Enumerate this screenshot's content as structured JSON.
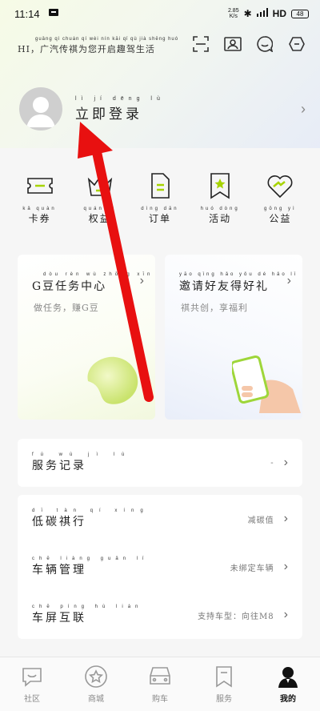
{
  "status": {
    "time": "11:14",
    "net_speed": "2.85",
    "net_unit": "K/s",
    "network": "HD",
    "battery": "48"
  },
  "header": {
    "greeting": "HI，广汽传祺为您开启趣驾生活",
    "greeting_pinyin": "guǎng qì chuán qí wèi nín kāi qǐ qù jià shēng huó"
  },
  "profile": {
    "login_label": "立即登录",
    "login_pinyin": "lì jí dēng lù"
  },
  "quick_actions": [
    {
      "icon": "ticket-icon",
      "label": "卡券",
      "pinyin": "kǎ quàn"
    },
    {
      "icon": "crown-icon",
      "label": "权益",
      "pinyin": "quán yì"
    },
    {
      "icon": "order-icon",
      "label": "订单",
      "pinyin": "dìng dān"
    },
    {
      "icon": "star-bookmark-icon",
      "label": "活动",
      "pinyin": "huó dòng"
    },
    {
      "icon": "handshake-heart-icon",
      "label": "公益",
      "pinyin": "gōng yì"
    }
  ],
  "cards": {
    "task": {
      "title": "G豆任务中心",
      "title_pinyin": "dòu rèn wù zhōng xīn",
      "sub": "做任务，赚G豆"
    },
    "invite": {
      "title": "邀请好友得好礼",
      "title_pinyin": "yāo qǐng hǎo yǒu dé hǎo lǐ",
      "sub": "祺共创，享福利"
    }
  },
  "service": {
    "label": "服务记录",
    "pinyin": "fú wù jì lù",
    "value": "-"
  },
  "settings": [
    {
      "label": "低碳祺行",
      "pinyin": "dī tàn qí xíng",
      "value": "减碳值"
    },
    {
      "label": "车辆管理",
      "pinyin": "chē liàng guǎn lǐ",
      "value": "未绑定车辆"
    },
    {
      "label": "车屏互联",
      "pinyin": "chē píng hù lián",
      "value": "支持车型：向往M8"
    }
  ],
  "nav": [
    {
      "icon": "community-chat-icon",
      "label": "社区"
    },
    {
      "icon": "mall-star-icon",
      "label": "商城"
    },
    {
      "icon": "car-icon",
      "label": "购车"
    },
    {
      "icon": "service-bookmark-icon",
      "label": "服务"
    },
    {
      "icon": "profile-person-icon",
      "label": "我的",
      "active": true
    }
  ],
  "colors": {
    "accent": "#a7d400",
    "arrow": "#e81010"
  }
}
